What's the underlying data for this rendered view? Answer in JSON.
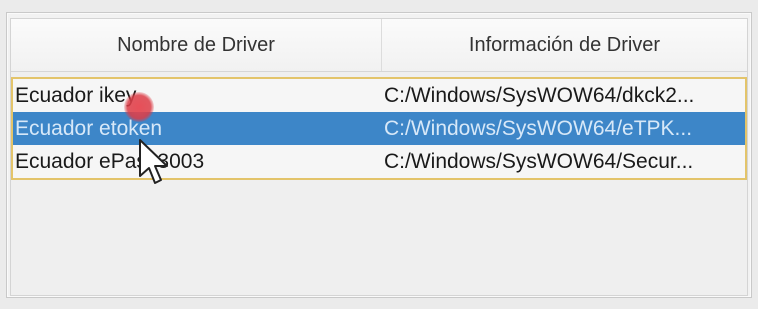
{
  "driver_list": {
    "columns": [
      "Nombre de Driver",
      "Información de Driver"
    ],
    "rows": [
      {
        "name": "Ecuador ikey",
        "info": "C:/Windows/SysWOW64/dkck2..."
      },
      {
        "name": "Ecuador etoken",
        "info": "C:/Windows/SysWOW64/eTPK...",
        "selected": true
      },
      {
        "name": "Ecuador ePass3003",
        "info": "C:/Windows/SysWOW64/Secur..."
      }
    ]
  },
  "icons": {
    "cursor": "arrow-pointer-icon",
    "click_marker": "click-indicator"
  },
  "colors": {
    "selection": "#3d86c8",
    "row_border": "#e3c46a",
    "click_marker": "#e24a57"
  }
}
